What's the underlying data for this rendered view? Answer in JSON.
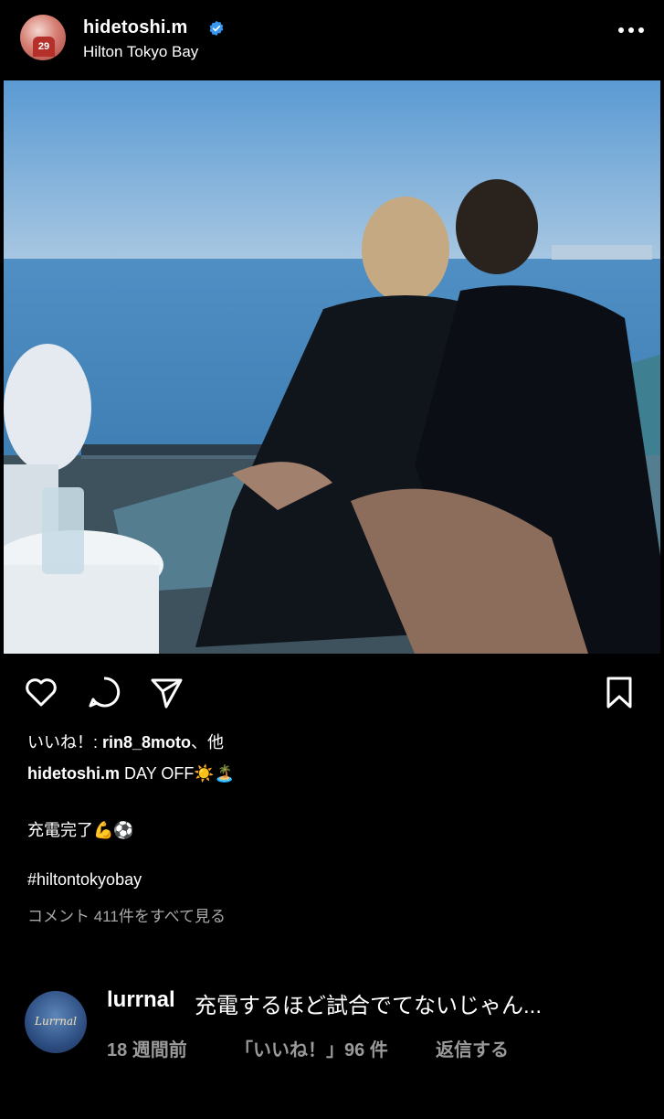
{
  "post": {
    "username": "hidetoshi.m",
    "location": "Hilton Tokyo Bay",
    "avatar_jersey_number": "29"
  },
  "actions": {
    "like_icon": "heart-icon",
    "comment_icon": "comment-icon",
    "share_icon": "send-icon",
    "save_icon": "bookmark-icon",
    "more_icon": "more-dots-icon"
  },
  "likes": {
    "prefix": "いいね！: ",
    "user": "rin8_8moto",
    "suffix": "、他"
  },
  "caption": {
    "username": "hidetoshi.m",
    "text": "DAY OFF☀️🏝️",
    "line2": "充電完了💪⚽",
    "hashtag": "#hiltontokyobay"
  },
  "view_comments": "コメント 411件をすべて見る",
  "comment": {
    "username": "lurrnal",
    "text": "充電するほど試合でてないじゃん...",
    "avatar_text": "Lurrnal",
    "time": "18 週間前",
    "likes": "「いいね！」96 件",
    "reply": "返信する"
  },
  "colors": {
    "background": "#000000",
    "verified": "#3897f0",
    "muted": "#a8a8a8"
  }
}
